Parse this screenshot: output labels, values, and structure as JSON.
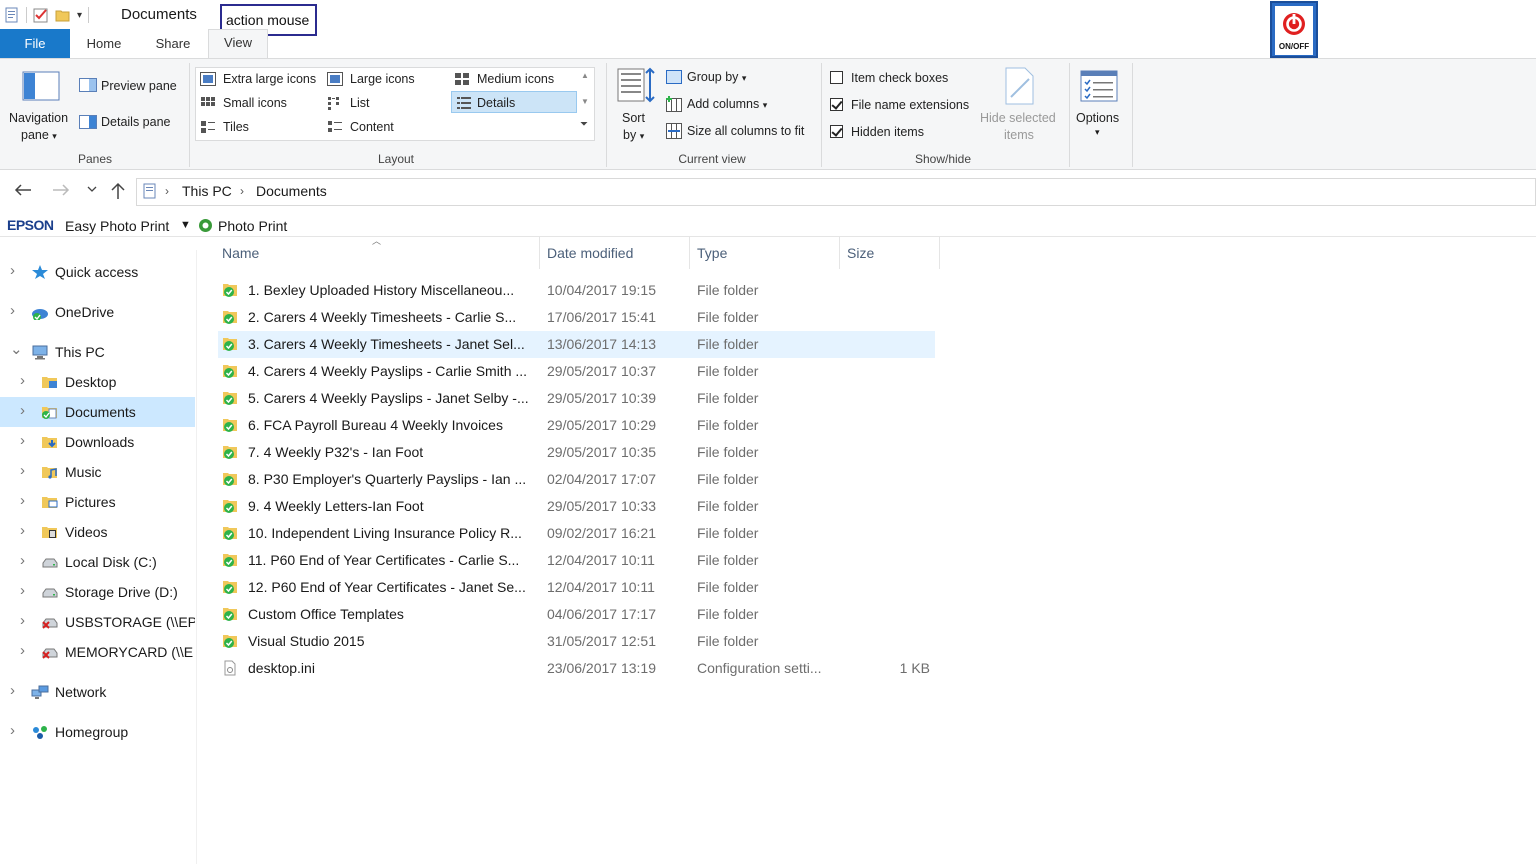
{
  "window": {
    "title": "Documents"
  },
  "overlay": {
    "label": "action mouse",
    "power_label": "ON/OFF"
  },
  "tabs": {
    "file": "File",
    "home": "Home",
    "share": "Share",
    "view": "View"
  },
  "ribbon": {
    "panes": {
      "group_label": "Panes",
      "navigation_pane": "Navigation",
      "navigation_pane2": "pane",
      "preview_pane": "Preview pane",
      "details_pane": "Details pane"
    },
    "layout": {
      "group_label": "Layout",
      "extra_large_icons": "Extra large icons",
      "large_icons": "Large icons",
      "medium_icons": "Medium icons",
      "small_icons": "Small icons",
      "list": "List",
      "details": "Details",
      "tiles": "Tiles",
      "content": "Content"
    },
    "current_view": {
      "group_label": "Current view",
      "sort_by": "Sort",
      "sort_by2": "by",
      "group_by": "Group by",
      "add_columns": "Add columns",
      "size_all_columns": "Size all columns to fit"
    },
    "show_hide": {
      "group_label": "Show/hide",
      "item_check_boxes": "Item check boxes",
      "item_check_boxes_checked": false,
      "file_name_extensions": "File name extensions",
      "file_name_extensions_checked": true,
      "hidden_items": "Hidden items",
      "hidden_items_checked": true,
      "hide_selected": "Hide selected",
      "hide_selected2": "items"
    },
    "options": {
      "label": "Options"
    }
  },
  "address": {
    "crumbs": [
      "This PC",
      "Documents"
    ]
  },
  "epson": {
    "brand": "EPSON",
    "easy_photo_print": "Easy Photo Print",
    "photo_print": "Photo Print"
  },
  "nav": {
    "items": [
      {
        "label": "Quick access"
      },
      {
        "label": "OneDrive"
      },
      {
        "label": "This PC"
      },
      {
        "label": "Desktop"
      },
      {
        "label": "Documents"
      },
      {
        "label": "Downloads"
      },
      {
        "label": "Music"
      },
      {
        "label": "Pictures"
      },
      {
        "label": "Videos"
      },
      {
        "label": "Local Disk (C:)"
      },
      {
        "label": "Storage Drive (D:)"
      },
      {
        "label": "USBSTORAGE (\\\\EPS"
      },
      {
        "label": "MEMORYCARD (\\\\E"
      },
      {
        "label": "Network"
      },
      {
        "label": "Homegroup"
      }
    ]
  },
  "columns": {
    "name": "Name",
    "date": "Date modified",
    "type": "Type",
    "size": "Size"
  },
  "files": [
    {
      "name": "1. Bexley Uploaded History Miscellaneou...",
      "date": "10/04/2017 19:15",
      "type": "File folder",
      "size": ""
    },
    {
      "name": "2. Carers 4 Weekly Timesheets - Carlie S...",
      "date": "17/06/2017 15:41",
      "type": "File folder",
      "size": ""
    },
    {
      "name": "3. Carers 4 Weekly Timesheets - Janet Sel...",
      "date": "13/06/2017 14:13",
      "type": "File folder",
      "size": ""
    },
    {
      "name": "4. Carers 4 Weekly Payslips - Carlie Smith ...",
      "date": "29/05/2017 10:37",
      "type": "File folder",
      "size": ""
    },
    {
      "name": "5. Carers 4 Weekly Payslips - Janet Selby -...",
      "date": "29/05/2017 10:39",
      "type": "File folder",
      "size": ""
    },
    {
      "name": "6. FCA Payroll Bureau 4 Weekly Invoices",
      "date": "29/05/2017 10:29",
      "type": "File folder",
      "size": ""
    },
    {
      "name": "7. 4 Weekly P32's - Ian Foot",
      "date": "29/05/2017 10:35",
      "type": "File folder",
      "size": ""
    },
    {
      "name": "8. P30 Employer's Quarterly Payslips - Ian ...",
      "date": "02/04/2017 17:07",
      "type": "File folder",
      "size": ""
    },
    {
      "name": "9. 4 Weekly Letters-Ian Foot",
      "date": "29/05/2017 10:33",
      "type": "File folder",
      "size": ""
    },
    {
      "name": "10. Independent Living Insurance Policy R...",
      "date": "09/02/2017 16:21",
      "type": "File folder",
      "size": ""
    },
    {
      "name": "11. P60 End of Year Certificates - Carlie S...",
      "date": "12/04/2017 10:11",
      "type": "File folder",
      "size": ""
    },
    {
      "name": "12. P60 End of Year Certificates - Janet Se...",
      "date": "12/04/2017 10:11",
      "type": "File folder",
      "size": ""
    },
    {
      "name": "Custom Office Templates",
      "date": "04/06/2017 17:17",
      "type": "File folder",
      "size": ""
    },
    {
      "name": "Visual Studio 2015",
      "date": "31/05/2017 12:51",
      "type": "File folder",
      "size": ""
    },
    {
      "name": "desktop.ini",
      "date": "23/06/2017 13:19",
      "type": "Configuration setti...",
      "size": "1 KB"
    }
  ],
  "colors": {
    "accent": "#1979ca",
    "selected": "#cce8ff",
    "hover": "#e5f3ff",
    "sync_green": "#2db34a",
    "folder": "#f0c85a"
  }
}
